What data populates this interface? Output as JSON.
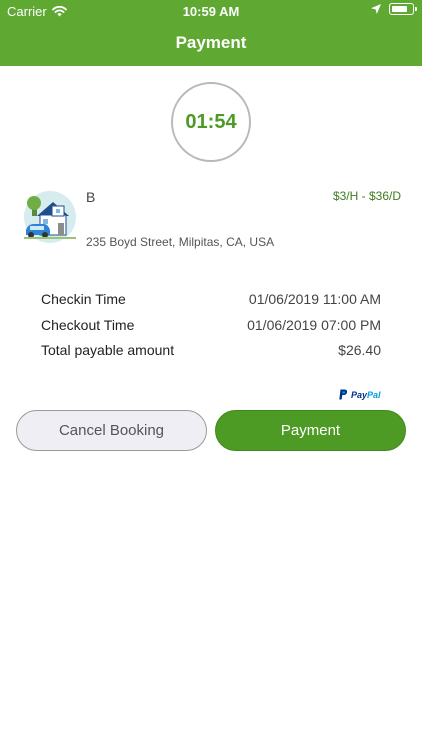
{
  "status_bar": {
    "carrier": "Carrier",
    "time": "10:59 AM"
  },
  "header": {
    "title": "Payment"
  },
  "timer": {
    "value": "01:54"
  },
  "spot": {
    "name": "B",
    "rate": "$3/H - $36/D",
    "address": "235 Boyd Street, Milpitas, CA, USA"
  },
  "details": [
    {
      "label": "Checkin Time",
      "value": "01/06/2019 11:00 AM"
    },
    {
      "label": "Checkout Time",
      "value": "01/06/2019 07:00 PM"
    },
    {
      "label": "Total payable amount",
      "value": "$26.40"
    }
  ],
  "paypal": {
    "part1": "Pay",
    "part2": "Pal"
  },
  "buttons": {
    "cancel": "Cancel Booking",
    "pay": "Payment"
  },
  "colors": {
    "brand_green": "#5fa932",
    "button_green": "#4d9b24",
    "timer_green": "#4d9a26"
  },
  "icons": {
    "wifi": "wifi-icon",
    "location": "location-arrow-icon",
    "battery": "battery-icon",
    "paypal": "paypal-logo-icon",
    "house": "house-car-icon"
  }
}
